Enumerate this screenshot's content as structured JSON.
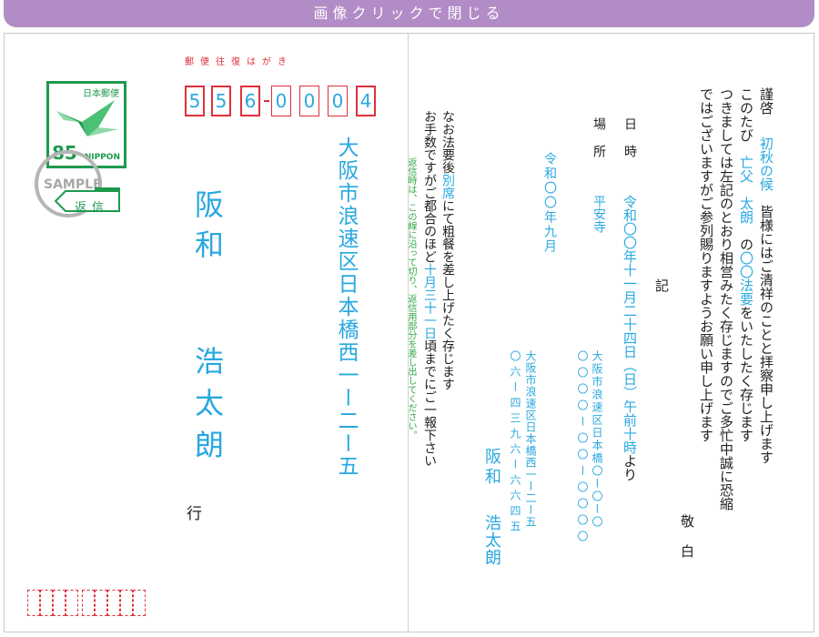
{
  "header": {
    "close_label": "画像クリックで閉じる"
  },
  "colors": {
    "header_bg": "#b28cc6",
    "accent_blue": "#29a8e0",
    "postal_red": "#e0303a",
    "stamp_green": "#1e9a4c"
  },
  "stamp": {
    "country": "日本郵便",
    "value": "85",
    "brand": "NIPPON",
    "sample": "SAMPLE",
    "reply_tag": "返信",
    "icon": "crane-icon"
  },
  "postal": {
    "label": "郵便往復はがき",
    "digits": [
      "5",
      "5",
      "6",
      "0",
      "0",
      "0",
      "4"
    ]
  },
  "address": {
    "line": "大阪市浪速区日本橋西一ー二ー五",
    "name_family": "阪和",
    "name_given": "浩太朗",
    "suffix": "行"
  },
  "cut_note": "返信時は、この線に沿って切り、返信用部分を差し出してください。",
  "notes": {
    "line1": [
      "なお法要後",
      "別席",
      "にて粗餐を差し上げたく存じます"
    ],
    "line2": [
      "お手数ですがご都合のほど",
      "十月三十一日",
      "頃までにご一報下さい"
    ]
  },
  "sender": {
    "address": "大阪市浪速区日本橋西一ー二ー五",
    "postal": "〇六ー四三九六ー六六四五",
    "name_family": "阪和",
    "name_given": "浩太朗",
    "branch_address": "大阪市浪速区日本橋〇ー〇ー〇",
    "branch_phone": "〇〇〇〇ー〇〇ー〇〇〇〇"
  },
  "date_sent": "令和〇〇年九月",
  "event": {
    "date_label": "日　時",
    "place_label": "場　所",
    "datetime": [
      "令和〇〇年十一月二十四日（日）午前十時",
      "より"
    ],
    "place": "平安寺",
    "ki": "記"
  },
  "letter": {
    "greeting": "謹啓",
    "season": "初秋の候",
    "line1_rest": "皆様にはご清祥のことと拝察申し上げます",
    "line2_pre": "このたび",
    "relation": "亡父",
    "deceased": "太朗",
    "line2_mid": "の",
    "memorial": "〇〇法要",
    "line2_post": "をいたしたく存じます",
    "line3": "つきましては左記のとおり相営みたく存じますのでご多忙中誠に恐縮",
    "line4": "ではございますがご参列賜りますようお願い申し上げます",
    "closing1": "敬",
    "closing2": "白"
  }
}
